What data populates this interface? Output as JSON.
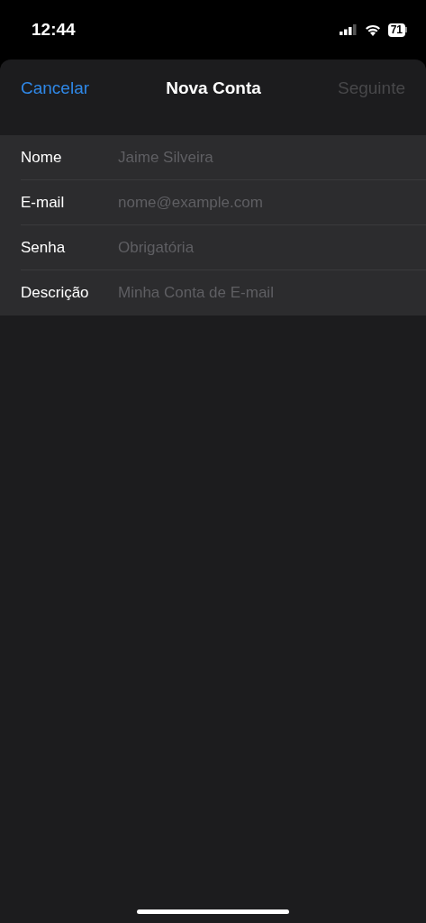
{
  "status_bar": {
    "time": "12:44",
    "battery": "71"
  },
  "nav": {
    "cancel": "Cancelar",
    "title": "Nova Conta",
    "next": {
      "label": "Seguinte",
      "disabled": true
    }
  },
  "fields": [
    {
      "label": "Nome",
      "placeholder": "Jaime Silveira"
    },
    {
      "label": "E-mail",
      "placeholder": "nome@example.com"
    },
    {
      "label": "Senha",
      "placeholder": "Obrigatória"
    },
    {
      "label": "Descrição",
      "placeholder": "Minha Conta de E-mail"
    }
  ]
}
